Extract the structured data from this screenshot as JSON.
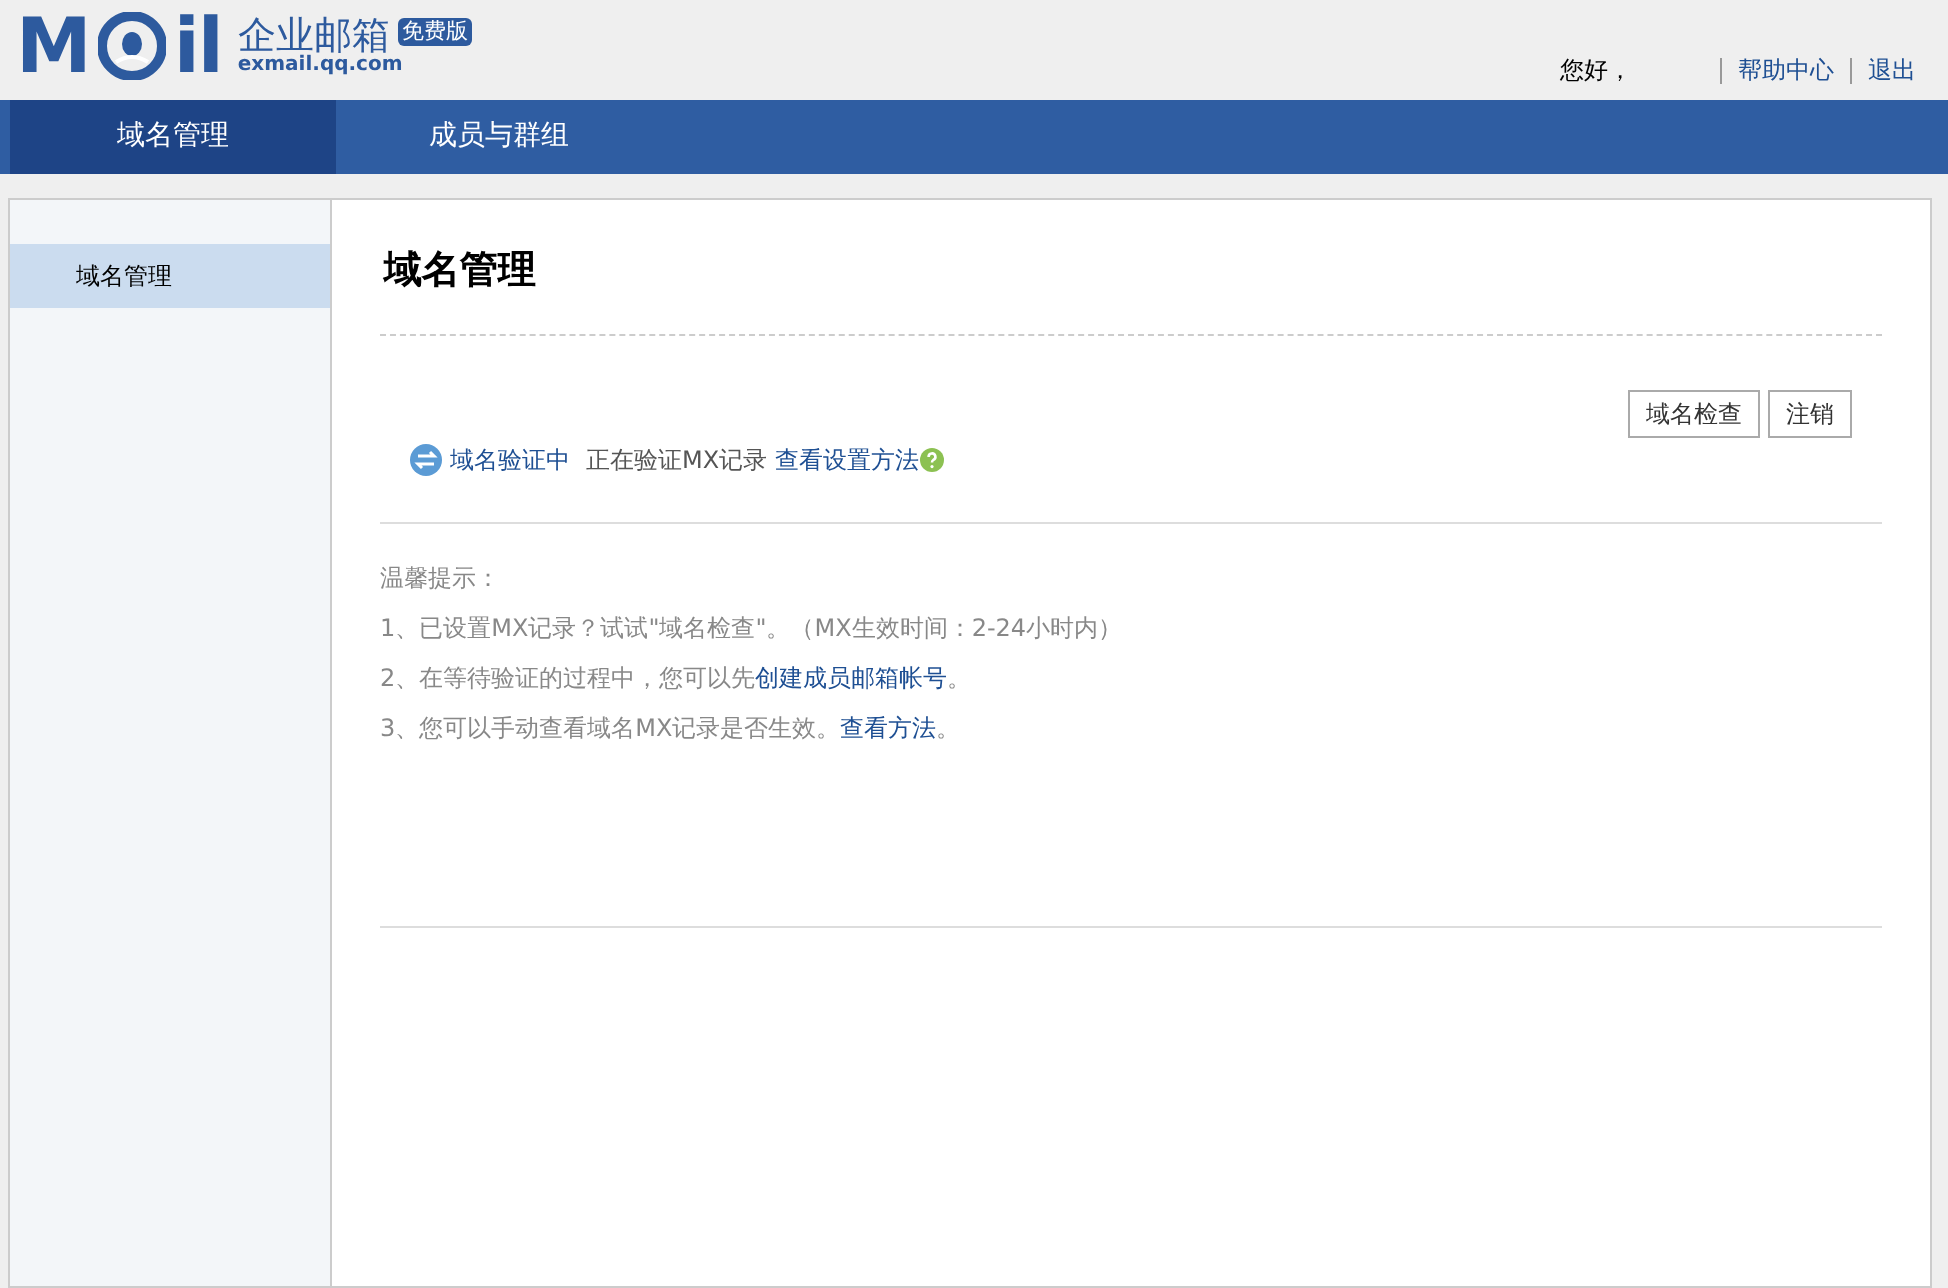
{
  "logo": {
    "left": "M",
    "right": "il",
    "product": "企业邮箱",
    "badge": "免费版",
    "domain": "exmail.qq.com"
  },
  "header": {
    "greeting": "您好，",
    "links": [
      "帮助中心",
      "退出"
    ]
  },
  "nav": [
    {
      "label": "域名管理",
      "selected": true
    },
    {
      "label": "成员与群组",
      "selected": false
    }
  ],
  "sidebar": {
    "items": [
      {
        "label": "域名管理",
        "selected": true
      }
    ]
  },
  "main": {
    "title": "域名管理",
    "buttons": [
      "域名检查",
      "注销"
    ],
    "status": {
      "state": "域名验证中",
      "message": "正在验证MX记录",
      "link": "查看设置方法"
    },
    "tips": {
      "heading": "温馨提示：",
      "items": [
        {
          "text": "1、已设置MX记录？试试\"域名检查\"。（MX生效时间：2-24小时内）"
        },
        {
          "text": "2、在等待验证的过程中，您可以先",
          "link": "创建成员邮箱帐号",
          "after": "。"
        },
        {
          "text": "3、您可以手动查看域名MX记录是否生效。",
          "link": "查看方法",
          "after": "。"
        }
      ]
    }
  }
}
